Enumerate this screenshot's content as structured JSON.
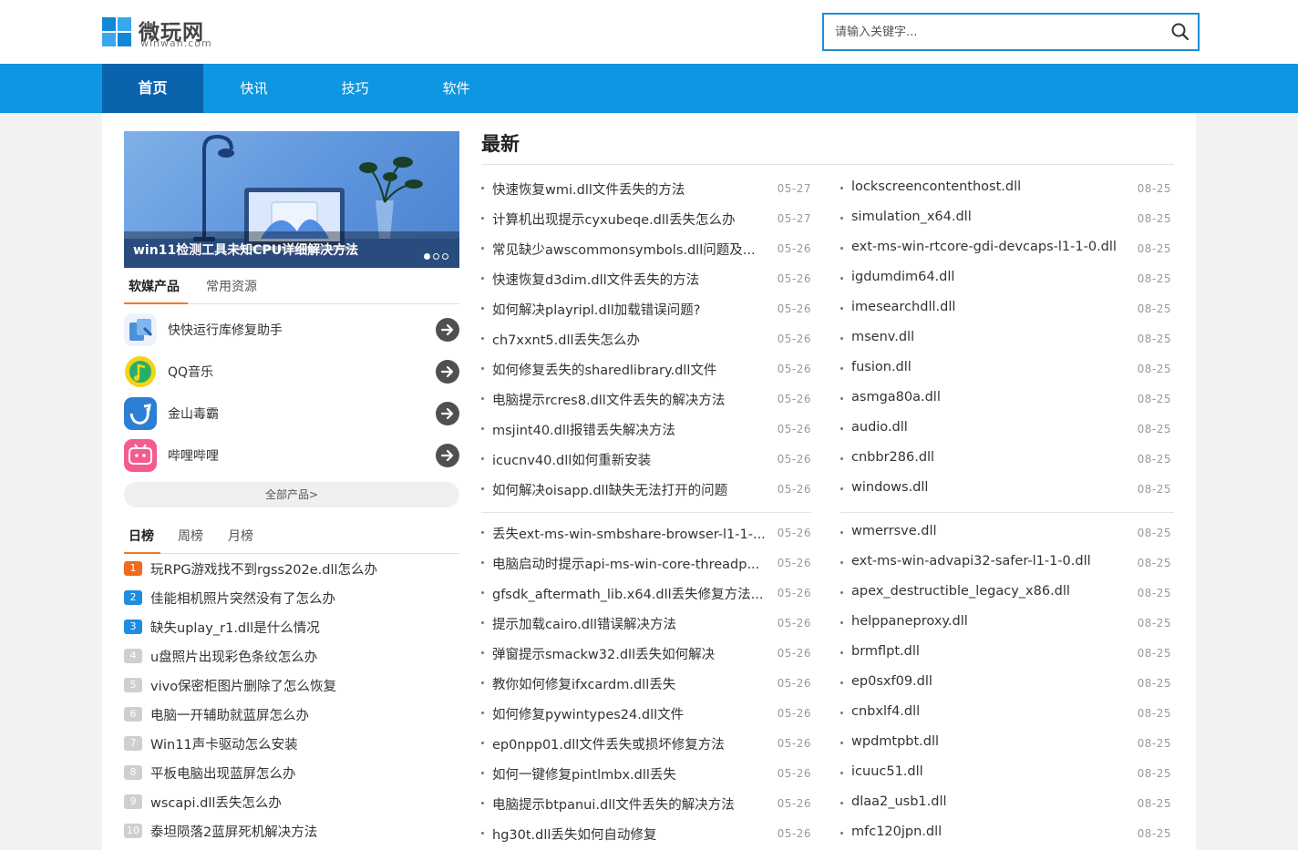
{
  "site": {
    "name_cn": "微玩网",
    "name_en": "winwan.com"
  },
  "search": {
    "placeholder": "请输入关键字..."
  },
  "nav": [
    "首页",
    "快讯",
    "技巧",
    "软件"
  ],
  "banner": {
    "title": "win11检测工具未知CPU详细解决方法",
    "slide": 1,
    "slides": 3
  },
  "product_tabs": [
    "软媒产品",
    "常用资源"
  ],
  "products": [
    "快快运行库修复助手",
    "QQ音乐",
    "金山毒霸",
    "哔哩哔哩"
  ],
  "all_products": "全部产品>",
  "rank_tabs": [
    "日榜",
    "周榜",
    "月榜"
  ],
  "rank": [
    "玩RPG游戏找不到rgss202e.dll怎么办",
    "佳能相机照片突然没有了怎么办",
    "缺失uplay_r1.dll是什么情况",
    "u盘照片出现彩色条纹怎么办",
    "vivo保密柜图片删除了怎么恢复",
    "电脑一开辅助就蓝屏怎么办",
    "Win11声卡驱动怎么安装",
    "平板电脑出现蓝屏怎么办",
    "wscapi.dll丢失怎么办",
    "泰坦陨落2蓝屏死机解决方法"
  ],
  "latest_title": "最新",
  "latest_left": [
    {
      "t": "快速恢复wmi.dll文件丢失的方法",
      "d": "05-27"
    },
    {
      "t": "计算机出现提示cyxubeqe.dll丢失怎么办",
      "d": "05-27"
    },
    {
      "t": "常见缺少awscommonsymbols.dll问题及...",
      "d": "05-26"
    },
    {
      "t": "快速恢复d3dim.dll文件丢失的方法",
      "d": "05-26"
    },
    {
      "t": "如何解决playripl.dll加载错误问题?",
      "d": "05-26"
    },
    {
      "t": "ch7xxnt5.dll丢失怎么办",
      "d": "05-26"
    },
    {
      "t": "如何修复丢失的sharedlibrary.dll文件",
      "d": "05-26"
    },
    {
      "t": "电脑提示rcres8.dll文件丢失的解决方法",
      "d": "05-26"
    },
    {
      "t": "msjint40.dll报错丢失解决方法",
      "d": "05-26"
    },
    {
      "t": "icucnv40.dll如何重新安装",
      "d": "05-26"
    },
    {
      "t": "如何解决oisapp.dll缺失无法打开的问题",
      "d": "05-26"
    },
    {
      "t": "丢失ext-ms-win-smbshare-browser-l1-1-...",
      "d": "05-26"
    },
    {
      "t": "电脑启动时提示api-ms-win-core-threadp...",
      "d": "05-26"
    },
    {
      "t": "gfsdk_aftermath_lib.x64.dll丢失修复方法...",
      "d": "05-26"
    },
    {
      "t": "提示加载cairo.dll错误解决方法",
      "d": "05-26"
    },
    {
      "t": "弹窗提示smackw32.dll丢失如何解决",
      "d": "05-26"
    },
    {
      "t": "教你如何修复ifxcardm.dll丢失",
      "d": "05-26"
    },
    {
      "t": "如何修复pywintypes24.dll文件",
      "d": "05-26"
    },
    {
      "t": "ep0npp01.dll文件丢失或损坏修复方法",
      "d": "05-26"
    },
    {
      "t": "如何一键修复pintlmbx.dll丢失",
      "d": "05-26"
    },
    {
      "t": "电脑提示btpanui.dll文件丢失的解决方法",
      "d": "05-26"
    },
    {
      "t": "hg30t.dll丢失如何自动修复",
      "d": "05-26"
    }
  ],
  "latest_right": [
    {
      "t": "lockscreencontenthost.dll",
      "d": "08-25"
    },
    {
      "t": "simulation_x64.dll",
      "d": "08-25"
    },
    {
      "t": "ext-ms-win-rtcore-gdi-devcaps-l1-1-0.dll",
      "d": "08-25"
    },
    {
      "t": "igdumdim64.dll",
      "d": "08-25"
    },
    {
      "t": "imesearchdll.dll",
      "d": "08-25"
    },
    {
      "t": "msenv.dll",
      "d": "08-25"
    },
    {
      "t": "fusion.dll",
      "d": "08-25"
    },
    {
      "t": "asmga80a.dll",
      "d": "08-25"
    },
    {
      "t": "audio.dll",
      "d": "08-25"
    },
    {
      "t": "cnbbr286.dll",
      "d": "08-25"
    },
    {
      "t": "windows.dll",
      "d": "08-25"
    },
    {
      "t": "wmerrsve.dll",
      "d": "08-25"
    },
    {
      "t": "ext-ms-win-advapi32-safer-l1-1-0.dll",
      "d": "08-25"
    },
    {
      "t": "apex_destructible_legacy_x86.dll",
      "d": "08-25"
    },
    {
      "t": "helppaneproxy.dll",
      "d": "08-25"
    },
    {
      "t": "brmflpt.dll",
      "d": "08-25"
    },
    {
      "t": "ep0sxf09.dll",
      "d": "08-25"
    },
    {
      "t": "cnbxlf4.dll",
      "d": "08-25"
    },
    {
      "t": "wpdmtpbt.dll",
      "d": "08-25"
    },
    {
      "t": "icuuc51.dll",
      "d": "08-25"
    },
    {
      "t": "dlaa2_usb1.dll",
      "d": "08-25"
    },
    {
      "t": "mfc120jpn.dll",
      "d": "08-25"
    }
  ]
}
